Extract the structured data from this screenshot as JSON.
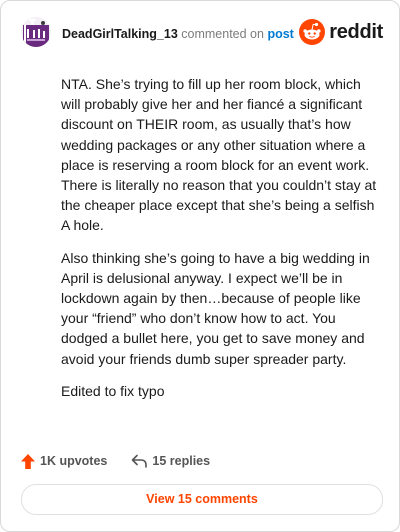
{
  "header": {
    "username": "DeadGirlTalking_13",
    "verb": "commented on",
    "post_link": "post",
    "brand": "reddit"
  },
  "comment": {
    "paragraphs": [
      "NTA. She’s trying to fill up her room block, which will probably give her and her fiancé a significant discount on THEIR room, as usually that’s how wedding packages or any other situation where a place is reserving a room block for an event work. There is literally no reason that you couldn’t stay at the cheaper place except that she’s being a selfish A hole.",
      "Also thinking she’s going to have a big wedding in April is delusional anyway. I expect we’ll be in lockdown again by then…because of people like your “friend” who don’t know how to act. You dodged a bullet here, you get to save money and avoid your friends dumb super spreader party.",
      "Edited to fix typo"
    ]
  },
  "footer": {
    "upvotes": "1K upvotes",
    "replies": "15 replies",
    "view_button": "View 15 comments"
  },
  "colors": {
    "accent": "#ff4500",
    "link": "#0079d3",
    "avatar": "#6a2a80"
  }
}
